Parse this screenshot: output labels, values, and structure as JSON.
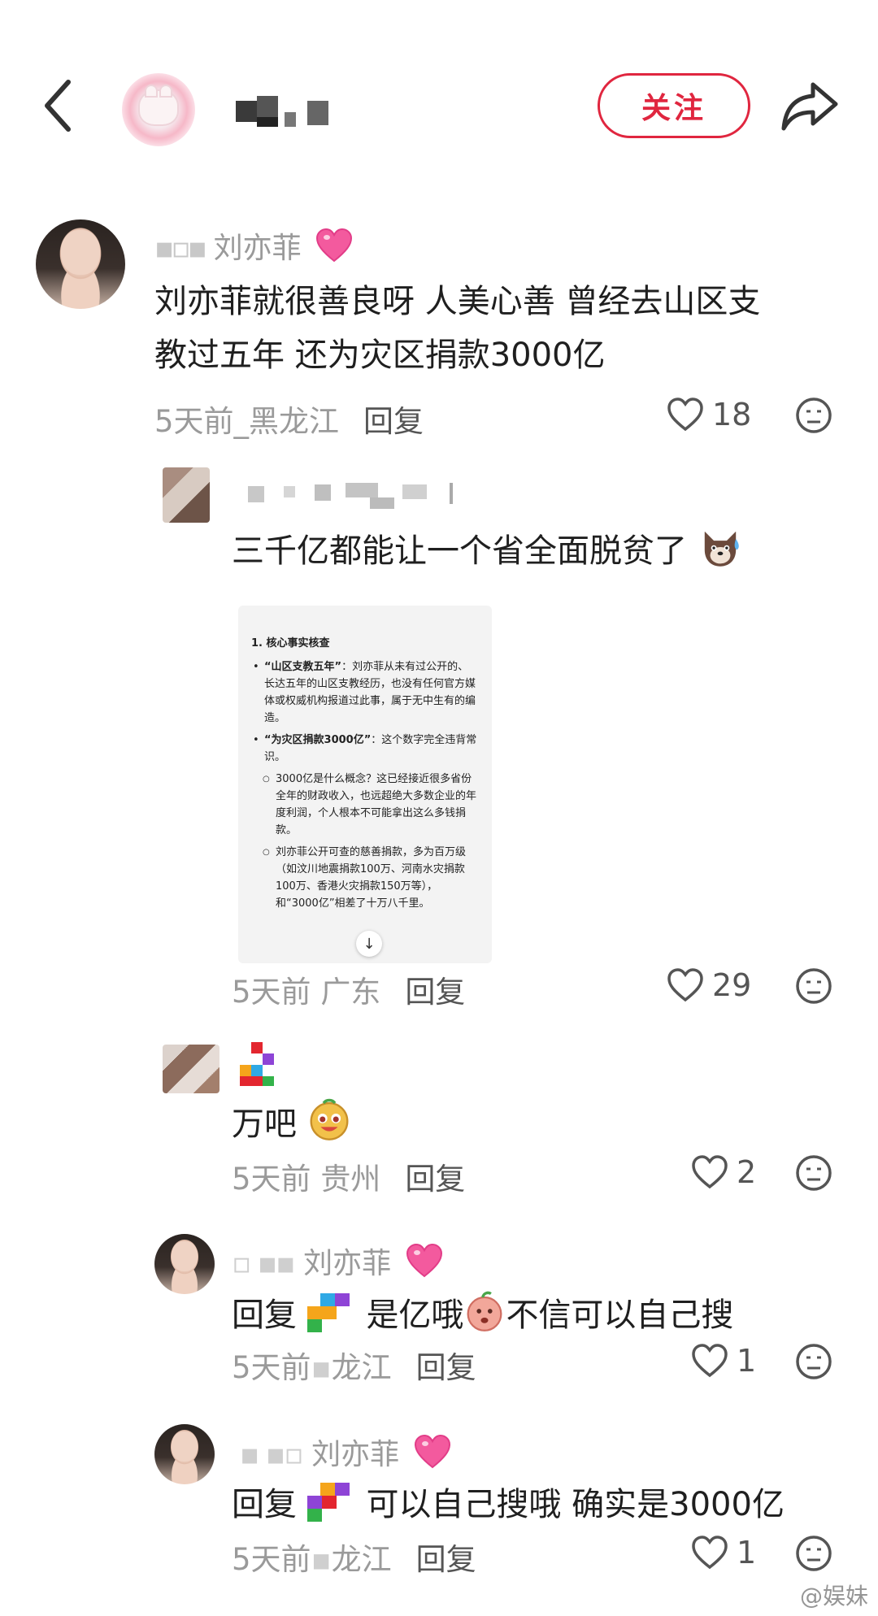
{
  "header": {
    "follow_label": "关注"
  },
  "comments": [
    {
      "username": "刘亦菲",
      "text_lines": [
        "刘亦菲就很善良呀 人美心善 曾经去山区支",
        "教过五年 还为灾区捐款3000亿"
      ],
      "time": "5天前",
      "location": "黑龙江",
      "reply_label": "回复",
      "likes": "18"
    },
    {
      "text": "三千亿都能让一个省全面脱贫了",
      "time": "5天前",
      "location": "广东",
      "reply_label": "回复",
      "likes": "29",
      "attachment": {
        "heading": "1. 核心事实核查",
        "items": [
          {
            "bold": "“山区支教五年”",
            "text": "：刘亦菲从未有过公开的、长达五年的山区支教经历，也没有任何官方媒体或权威机构报道过此事，属于无中生有的编造。"
          },
          {
            "bold": "“为灾区捐款3000亿”",
            "text": "：这个数字完全违背常识。"
          }
        ],
        "subitems": [
          "3000亿是什么概念？这已经接近很多省份全年的财政收入，也远超绝大多数企业的年度利润，个人根本不可能拿出这么多钱捐款。",
          "刘亦菲公开可查的慈善捐款，多为百万级（如汶川地震捐款100万、河南水灾捐款100万、香港火灾捐款150万等），和“3000亿”相差了十万八千里。"
        ]
      }
    },
    {
      "text": "万吧",
      "time": "5天前",
      "location": "贵州",
      "reply_label": "回复",
      "likes": "2"
    },
    {
      "username": "刘亦菲",
      "reply_prefix": "回复",
      "text": "是亿哦",
      "text_after": "不信可以自己搜",
      "time": "5天前",
      "location": "龙江",
      "reply_label": "回复",
      "likes": "1"
    },
    {
      "username": "刘亦菲",
      "reply_prefix": "回复",
      "text": "可以自己搜哦 确实是3000亿",
      "time": "5天前",
      "location": "龙江",
      "reply_label": "回复",
      "likes": "1"
    }
  ],
  "watermark": "@娱妹",
  "colors": {
    "accent": "#e0263f",
    "meta": "#9a9a9a"
  }
}
